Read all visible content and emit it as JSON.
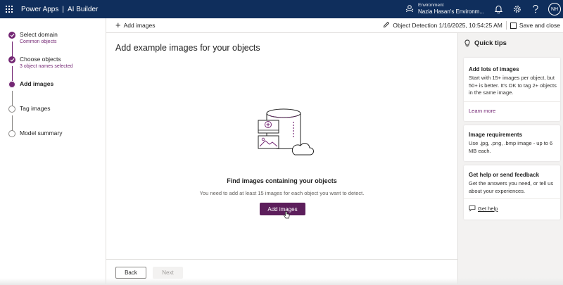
{
  "header": {
    "app_name": "Power Apps",
    "separator": "|",
    "product": "AI Builder",
    "environment_label": "Environment",
    "environment_name": "Nazia Hasan's Environm...",
    "avatar_initials": "NH",
    "icons": [
      "waffle-icon",
      "environment-icon",
      "bell-icon",
      "settings-icon",
      "help-icon"
    ]
  },
  "steps": [
    {
      "label": "Select domain",
      "sub": "Common objects",
      "status": "done"
    },
    {
      "label": "Choose objects",
      "sub": "3 object names selected",
      "status": "done"
    },
    {
      "label": "Add images",
      "sub": "",
      "status": "current"
    },
    {
      "label": "Tag images",
      "sub": "",
      "status": "todo"
    },
    {
      "label": "Model summary",
      "sub": "",
      "status": "todo"
    }
  ],
  "command_bar": {
    "add_images": "Add images",
    "model_info": "Object Detection 1/16/2025, 10:54:25 AM",
    "save_close": "Save and close"
  },
  "main": {
    "title": "Add example images for your objects",
    "empty_title": "Find images containing your objects",
    "empty_desc": "You need to add at least 15 images for each object you want to detect.",
    "add_button": "Add images",
    "back_button": "Back",
    "next_button": "Next"
  },
  "tips": {
    "title": "Quick tips",
    "cards": [
      {
        "title": "Add lots of images",
        "body": "Start with 15+ images per object, but 50+ is better. It's OK to tag 2+ objects in the same image.",
        "link": "Learn more"
      },
      {
        "title": "Image requirements",
        "body": "Use .jpg, .png, .bmp image - up to 6 MB each."
      },
      {
        "title": "Get help or send feedback",
        "body": "Get the answers you need, or tell us about your experiences.",
        "link": "Get help"
      }
    ]
  },
  "colors": {
    "header_bg": "#0f2e5c",
    "accent": "#742774",
    "primary_button": "#5c1e5b"
  }
}
